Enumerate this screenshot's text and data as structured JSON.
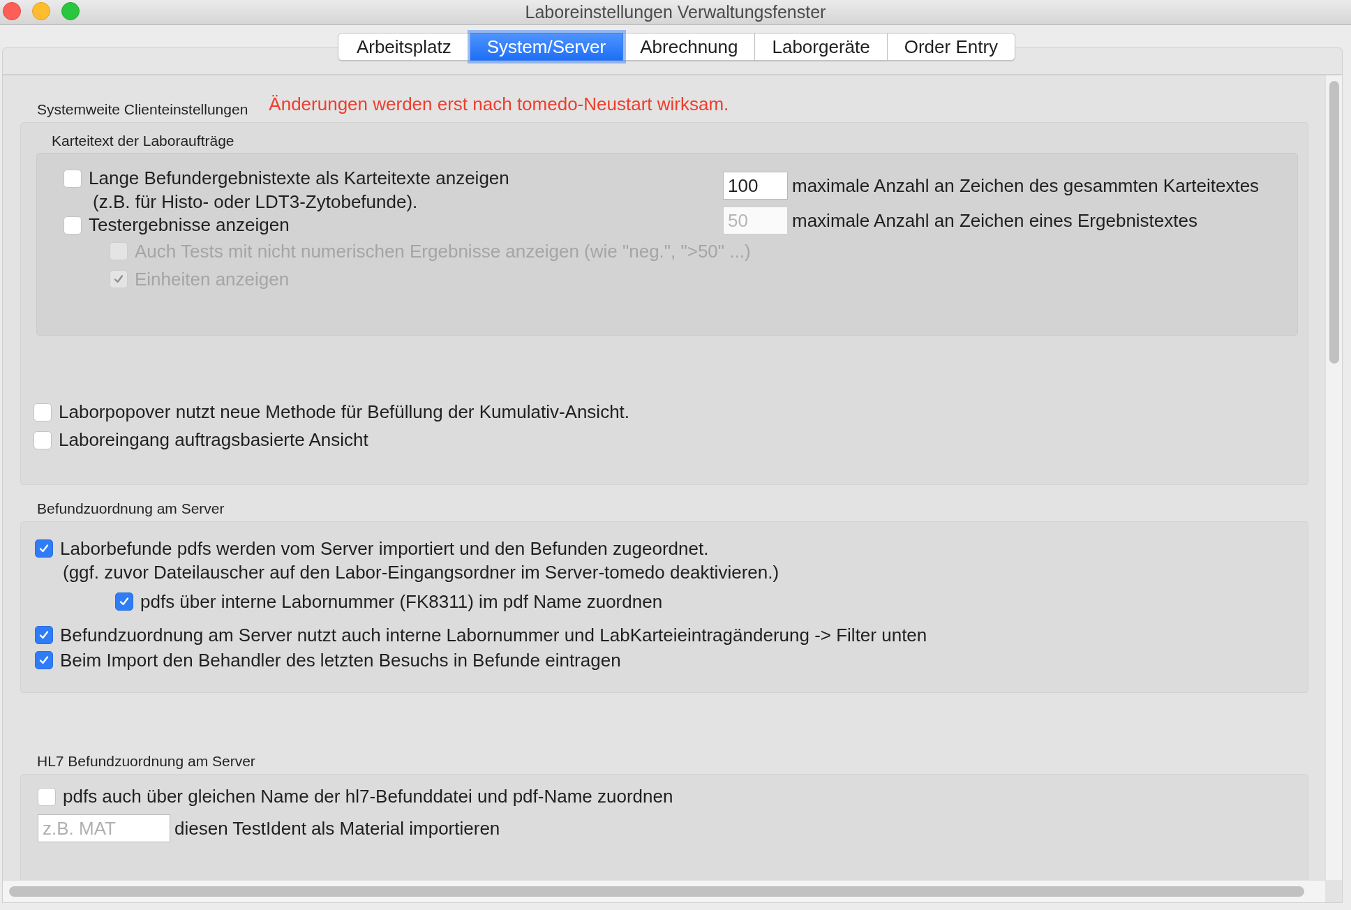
{
  "window": {
    "title": "Laboreinstellungen Verwaltungsfenster"
  },
  "tabs": [
    {
      "label": "Arbeitsplatz",
      "selected": false
    },
    {
      "label": "System/Server",
      "selected": true
    },
    {
      "label": "Abrechnung",
      "selected": false
    },
    {
      "label": "Laborgeräte",
      "selected": false
    },
    {
      "label": "Order Entry",
      "selected": false
    }
  ],
  "notice": "Änderungen werden erst nach tomedo-Neustart wirksam.",
  "client_settings": {
    "title": "Systemweite Clienteinstellungen",
    "card_text": {
      "title": "Karteitext der Laboraufträge",
      "options": [
        {
          "label": "Lange Befundergebnistexte als Karteitexte anzeigen",
          "note": "(z.B. für Histo- oder LDT3-Zytobefunde).",
          "checked": false,
          "disabled": false
        },
        {
          "label": "Testergebnisse anzeigen",
          "checked": false,
          "disabled": false,
          "children": [
            {
              "label": "Auch Tests mit nicht numerischen Ergebnisse anzeigen (wie \"neg.\", \">50\" ...)",
              "checked": false,
              "disabled": true
            },
            {
              "label": "Einheiten anzeigen",
              "checked": true,
              "disabled": true
            }
          ]
        }
      ],
      "limits": [
        {
          "value": "100",
          "disabled": false,
          "label": "maximale Anzahl an Zeichen des gesammten Karteitextes"
        },
        {
          "value": "50",
          "disabled": true,
          "label": "maximale Anzahl an Zeichen eines Ergebnistextes"
        }
      ]
    },
    "options": [
      {
        "label": "Laborpopover nutzt neue Methode für Befüllung der Kumulativ-Ansicht.",
        "checked": false,
        "disabled": false
      },
      {
        "label": "Laboreingang auftragsbasierte Ansicht",
        "checked": false,
        "disabled": false
      }
    ]
  },
  "server_assignment": {
    "title": "Befundzuordnung am Server",
    "options": [
      {
        "label": "Laborbefunde pdfs werden vom Server importiert und den Befunden zugeordnet.",
        "note": "(ggf. zuvor Dateilauscher auf den Labor-Eingangsordner im Server-tomedo deaktivieren.)",
        "checked": true,
        "disabled": false,
        "children": [
          {
            "label": "pdfs über interne Labornummer (FK8311) im pdf Name zuordnen",
            "checked": true,
            "disabled": false
          }
        ]
      },
      {
        "label": "Befundzuordnung am Server nutzt auch interne Labornummer und LabKarteieintragänderung -> Filter unten",
        "checked": true,
        "disabled": false
      },
      {
        "label": "Beim Import den Behandler des letzten Besuchs in Befunde eintragen",
        "checked": true,
        "disabled": false
      }
    ]
  },
  "hl7_assignment": {
    "title": "HL7 Befundzuordnung am Server",
    "options": [
      {
        "label": "pdfs auch über gleichen Name der hl7-Befunddatei und pdf-Name zuordnen",
        "checked": false,
        "disabled": false
      }
    ],
    "material_field": {
      "placeholder": "z.B. MAT",
      "label": "diesen TestIdent als Material importieren"
    }
  }
}
